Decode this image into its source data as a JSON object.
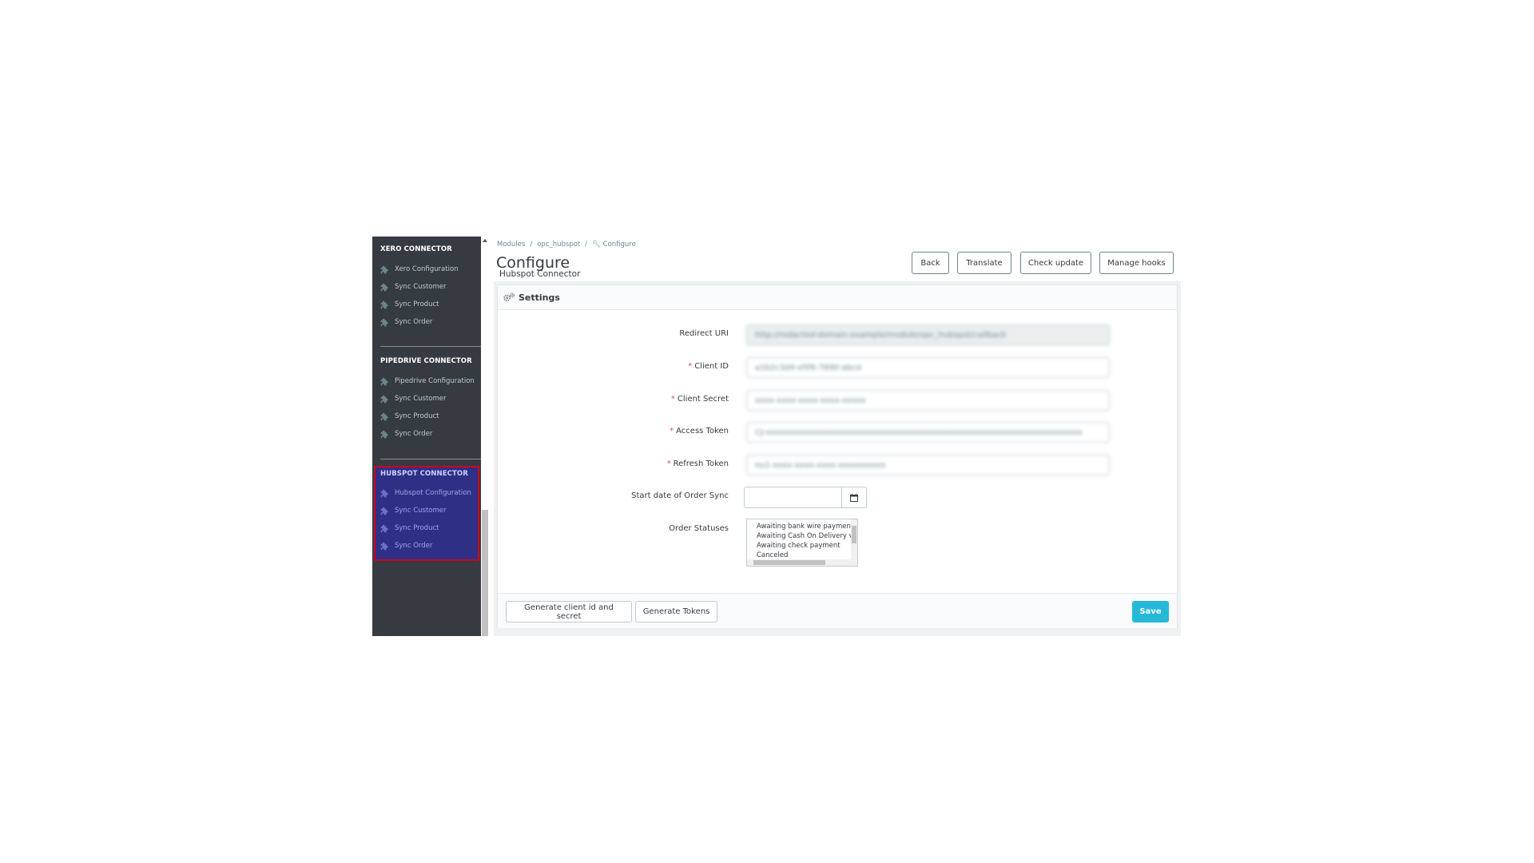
{
  "sidebar": {
    "sections": [
      {
        "title": "XERO CONNECTOR",
        "items": [
          "Xero Configuration",
          "Sync Customer",
          "Sync Product",
          "Sync Order"
        ]
      },
      {
        "title": "PIPEDRIVE CONNECTOR",
        "items": [
          "Pipedrive Configuration",
          "Sync Customer",
          "Sync Product",
          "Sync Order"
        ]
      },
      {
        "title": "HUBSPOT CONNECTOR",
        "items": [
          "Hubspot Configuration",
          "Sync Customer",
          "Sync Product",
          "Sync Order"
        ]
      }
    ],
    "item_icon": "puzzle-piece-icon"
  },
  "breadcrumb": {
    "items": [
      "Modules",
      "opc_hubspot",
      "Configure"
    ],
    "separator": "/"
  },
  "header": {
    "title": "Configure",
    "subtitle": "Hubspot Connector",
    "buttons": {
      "back": "Back",
      "translate": "Translate",
      "check_update": "Check update",
      "manage_hooks": "Manage hooks"
    }
  },
  "panel": {
    "heading": "Settings",
    "fields": {
      "redirect_uri": {
        "label": "Redirect URI",
        "value": "http://redacted-domain.example/module/opc_hubspot/callback",
        "required": false
      },
      "client_id": {
        "label": "Client ID",
        "value": "a1b2c3d4-e5f6-7890-abcd",
        "required": true
      },
      "client_secret": {
        "label": "Client Secret",
        "value": "xxxx-xxxx-xxxx-xxxx-xxxxx",
        "required": true
      },
      "access_token": {
        "label": "Access Token",
        "value": "CJ-xxxxxxxxxxxxxxxxxxxxxxxxxxxxxxxxxxxxxxxxxxxxxxxxxxxxxxxxxxxxxxxxxxx",
        "required": true
      },
      "refresh_token": {
        "label": "Refresh Token",
        "value": "eu1-xxxx-xxxx-xxxx-xxxxxxxxxx",
        "required": true
      },
      "start_date": {
        "label": "Start date of Order Sync",
        "value": ""
      },
      "order_statuses": {
        "label": "Order Statuses",
        "options": [
          "Awaiting bank wire payment",
          "Awaiting Cash On Delivery validation",
          "Awaiting check payment",
          "Canceled"
        ]
      }
    },
    "footer": {
      "generate_client": "Generate client id and secret",
      "generate_tokens": "Generate Tokens",
      "save": "Save"
    }
  },
  "colors": {
    "sidebar_bg": "#363a41",
    "highlight_bg": "#2f2f86",
    "highlight_border": "#d0021b",
    "primary": "#25b9d7",
    "required": "#c05c67"
  }
}
